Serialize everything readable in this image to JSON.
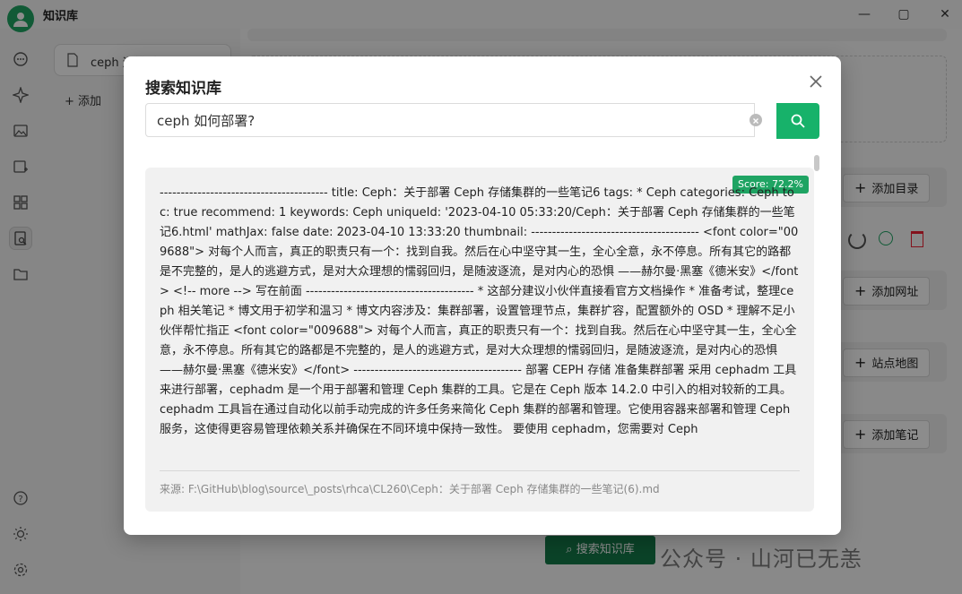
{
  "app": {
    "title": "知识库"
  },
  "window_controls": {
    "minimize": "—",
    "maximize": "▢",
    "close": "✕"
  },
  "sidebar": {
    "icons": [
      "chat-icon",
      "sparkle-icon",
      "image-icon",
      "image-edit-icon",
      "grid-icon",
      "knowledge-search-icon",
      "folder-icon",
      "help-icon",
      "theme-icon",
      "settings-icon"
    ],
    "active": "knowledge-search-icon"
  },
  "knowledge_panel": {
    "items": [
      {
        "label": "ceph 运维手册"
      }
    ],
    "add_label": "添加"
  },
  "main": {
    "buttons": {
      "add_directory": "添加目录",
      "add_url": "添加网址",
      "sitemap": "站点地图",
      "add_note": "添加笔记",
      "search_kb": "搜索知识库"
    },
    "watermark": "公众号 · 山河已无恙"
  },
  "modal": {
    "title": "搜索知识库",
    "search_value": "ceph 如何部署?",
    "score": "Score: 72.2%",
    "result_text": "---------------------------------------- title: Ceph：关于部署 Ceph 存储集群的一些笔记6 tags: * Ceph categories: Ceph toc: true recommend: 1 keywords: Ceph uniqueId: '2023-04-10 05:33:20/Ceph：关于部署 Ceph 存储集群的一些笔记6.html' mathJax: false date: 2023-04-10 13:33:20 thumbnail: ---------------------------------------- <font color=\"009688\"> 对每个人而言，真正的职责只有一个：找到自我。然后在心中坚守其一生，全心全意，永不停息。所有其它的路都是不完整的，是人的逃避方式，是对大众理想的懦弱回归，是随波逐流，是对内心的恐惧 ——赫尔曼·黑塞《德米安》</font> <!-- more --> 写在前面 ---------------------------------------- * 这部分建议小伙伴直接看官方文档操作 * 准备考试，整理ceph 相关笔记 * 博文用于初学和温习 * 博文内容涉及：集群部署，设置管理节点，集群扩容，配置额外的 OSD * 理解不足小伙伴帮忙指正 <font color=\"009688\"> 对每个人而言，真正的职责只有一个：找到自我。然后在心中坚守其一生，全心全意，永不停息。所有其它的路都是不完整的，是人的逃避方式，是对大众理想的懦弱回归，是随波逐流，是对内心的恐惧 ——赫尔曼·黑塞《德米安》</font> ---------------------------------------- 部署 CEPH 存储 准备集群部署 采用 cephadm 工具来进行部署，cephadm 是一个用于部署和管理 Ceph 集群的工具。它是在 Ceph 版本 14.2.0 中引入的相对较新的工具。 cephadm 工具旨在通过自动化以前手动完成的许多任务来简化 Ceph 集群的部署和管理。它使用容器来部署和管理 Ceph 服务，这使得更容易管理依赖关系并确保在不同环境中保持一致性。 要使用 cephadm，您需要对 Ceph",
    "source": "来源: F:\\GitHub\\blog\\source\\_posts\\rhca\\CL260\\Ceph：关于部署 Ceph 存储集群的一些笔记(6).md"
  }
}
